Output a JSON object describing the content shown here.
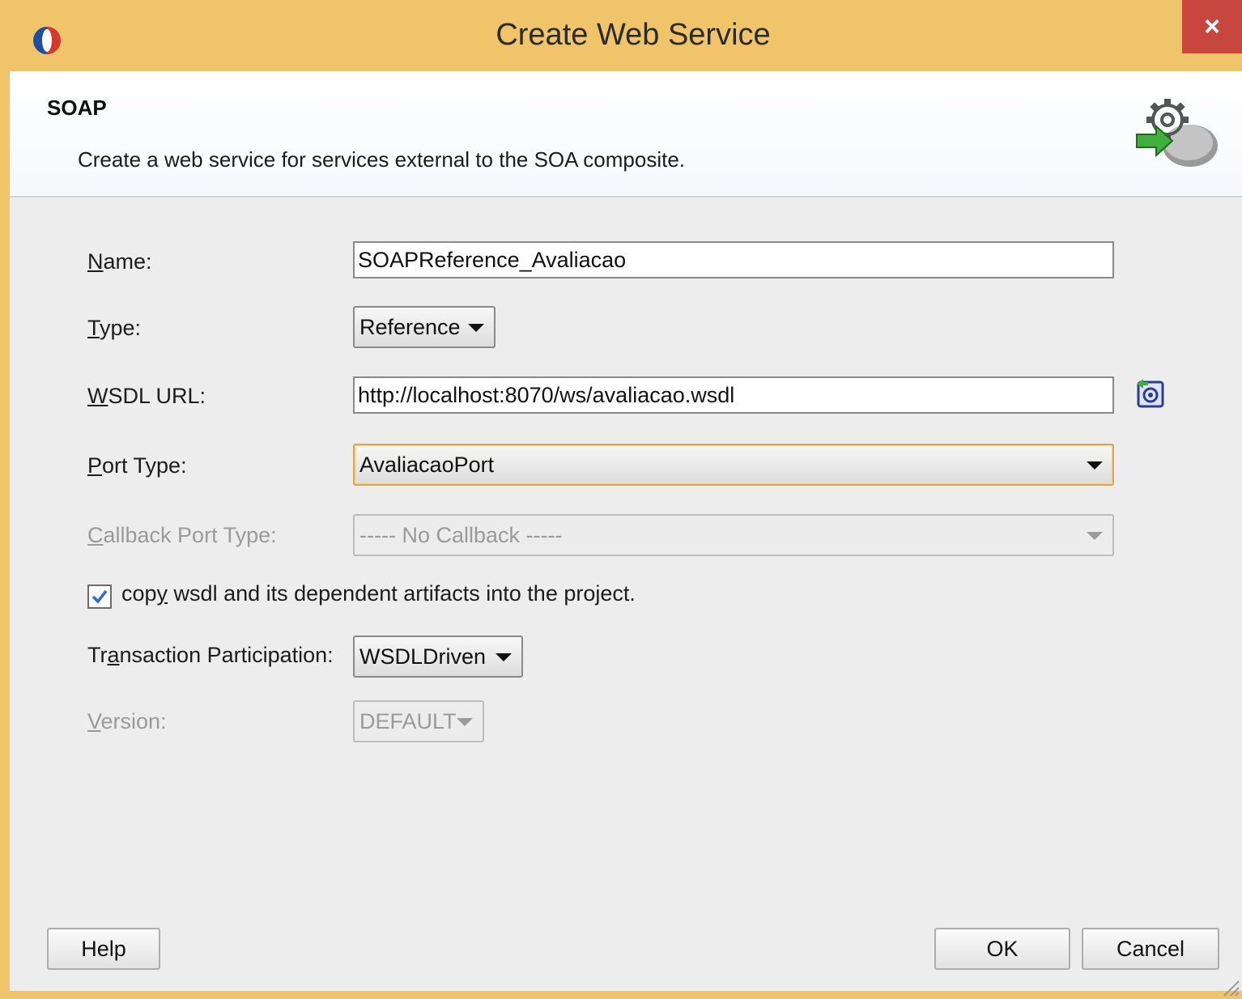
{
  "window": {
    "title": "Create Web Service",
    "close_glyph": "×"
  },
  "header": {
    "title": "SOAP",
    "description": "Create a web service for services external to the SOA composite."
  },
  "form": {
    "name": {
      "label_mnemonic": "N",
      "label_rest": "ame:",
      "value": "SOAPReference_Avaliacao"
    },
    "type": {
      "label_mnemonic": "T",
      "label_rest": "ype:",
      "value": "Reference"
    },
    "wsdl_url": {
      "label_mnemonic": "W",
      "label_rest": "SDL URL:",
      "value": "http://localhost:8070/ws/avaliacao.wsdl"
    },
    "port_type": {
      "label_mnemonic": "P",
      "label_rest": "ort Type:",
      "value": "AvaliacaoPort"
    },
    "callback_port_type": {
      "label_mnemonic": "C",
      "label_rest": "allback Port Type:",
      "value": "----- No Callback -----",
      "enabled": false
    },
    "copy_wsdl": {
      "label_before": "cop",
      "label_mnemonic": "y",
      "label_after": " wsdl and its dependent artifacts into the project.",
      "checked": true
    },
    "transaction_participation": {
      "label_before": "Tr",
      "label_mnemonic": "a",
      "label_after": "nsaction Participation:",
      "value": "WSDLDriven"
    },
    "version": {
      "label_mnemonic": "V",
      "label_rest": "ersion:",
      "value": "DEFAULT",
      "enabled": false
    }
  },
  "buttons": {
    "help": "Help",
    "ok": "OK",
    "cancel": "Cancel"
  },
  "icons": {
    "app": "oracle-jdeveloper-icon",
    "header": "gear-service-icon",
    "browse": "service-explorer-icon"
  },
  "colors": {
    "title_bar": "#f0c468",
    "close_button": "#c7463e",
    "focus_border": "#e2a54c",
    "check_mark": "#2a6fd1"
  }
}
